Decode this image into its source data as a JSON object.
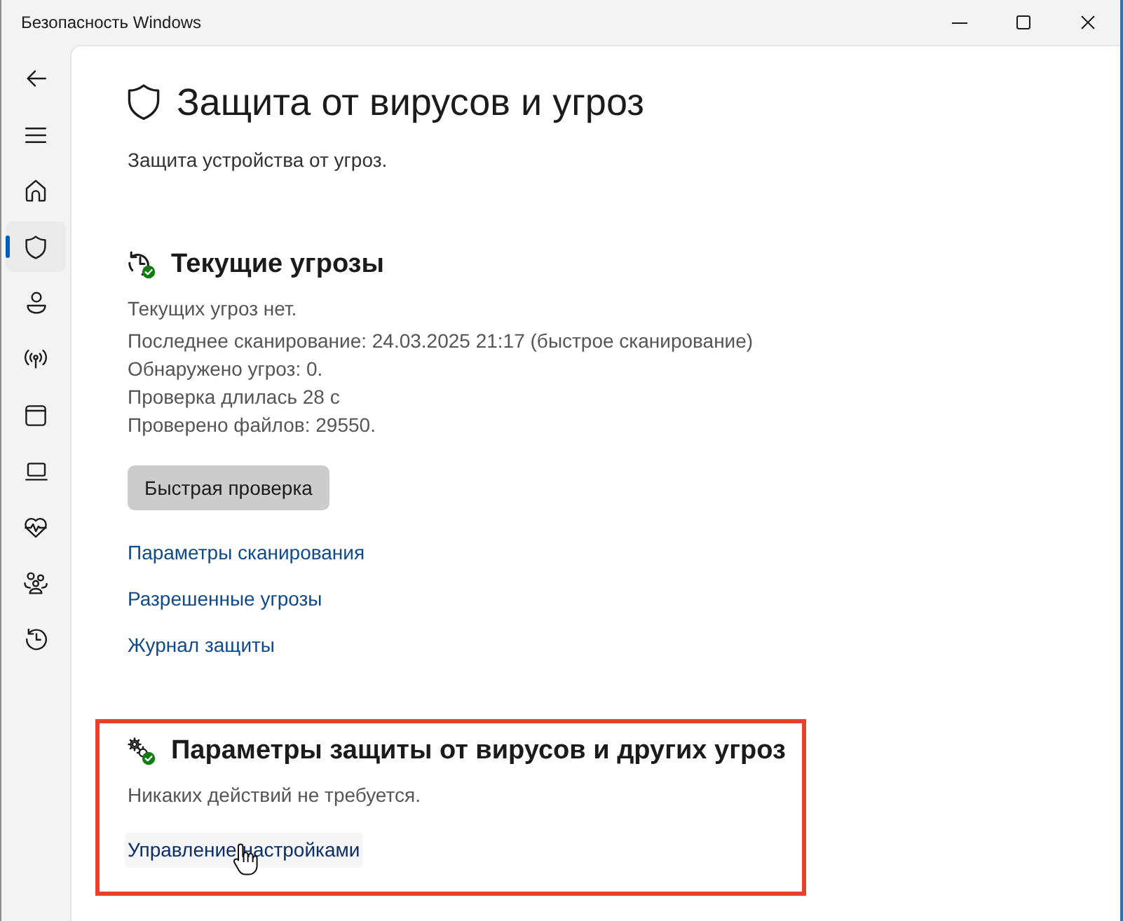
{
  "window": {
    "title": "Безопасность Windows"
  },
  "nav": {
    "items": [
      {
        "selected": false
      },
      {
        "selected": true
      },
      {
        "selected": false
      },
      {
        "selected": false
      },
      {
        "selected": false
      },
      {
        "selected": false
      },
      {
        "selected": false
      },
      {
        "selected": false
      },
      {
        "selected": false
      }
    ]
  },
  "page": {
    "title": "Защита от вирусов и угроз",
    "subtitle": "Защита устройства от угроз."
  },
  "sections": [
    {
      "heading": "Текущие угрозы",
      "highlighted": false,
      "status": "Текущих угроз нет.",
      "details": [
        "Последнее сканирование: 24.03.2025 21:17 (быстрое сканирование)",
        "Обнаружено угроз: 0.",
        "Проверка длилась 28 с",
        "Проверено файлов: 29550."
      ],
      "button": "Быстрая проверка",
      "links": [
        {
          "label": "Параметры сканирования",
          "hovered": false
        },
        {
          "label": "Разрешенные угрозы",
          "hovered": false
        },
        {
          "label": "Журнал защиты",
          "hovered": false
        }
      ]
    },
    {
      "heading": "Параметры защиты от вирусов и других угроз",
      "highlighted": true,
      "status": "Никаких действий не требуется.",
      "links": [
        {
          "label": "Управление настройками",
          "hovered": true
        }
      ]
    }
  ]
}
